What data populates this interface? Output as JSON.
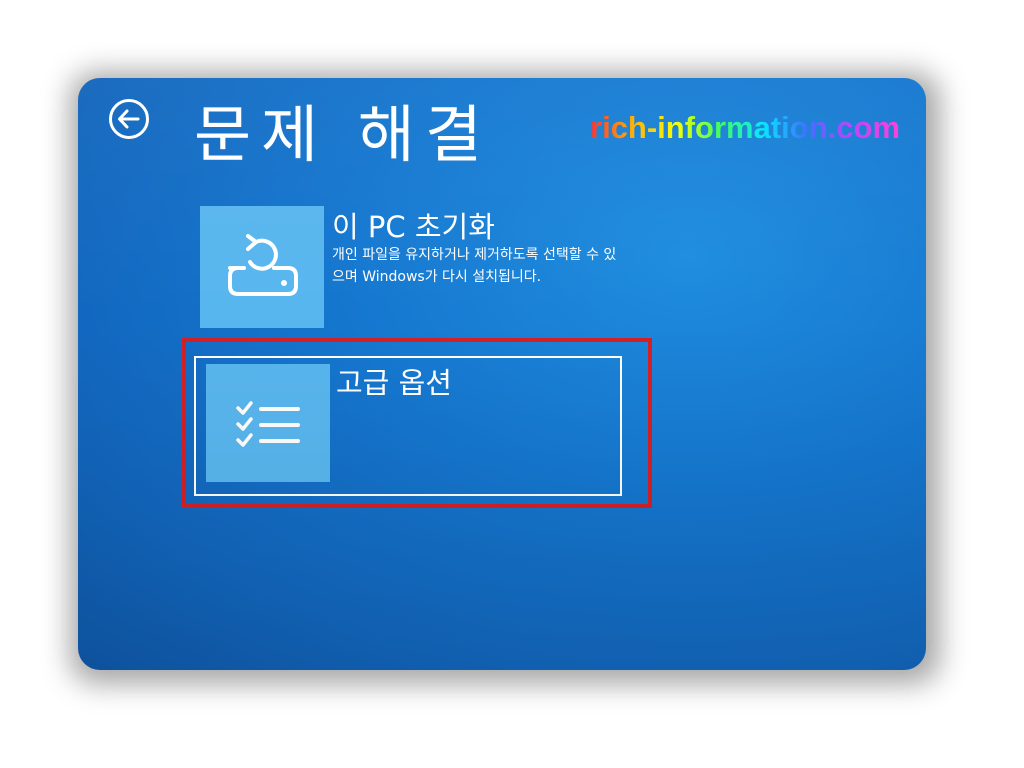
{
  "header": {
    "title": "문제 해결",
    "back_icon": "back-arrow-circle-icon"
  },
  "watermark": {
    "text": "rich-information.com"
  },
  "options": {
    "reset": {
      "title": "이 PC 초기화",
      "description": "개인 파일을 유지하거나 제거하도록 선택할 수 있으며 Windows가 다시 설치됩니다.",
      "icon": "reset-pc-icon"
    },
    "advanced": {
      "title": "고급 옵션",
      "icon": "checklist-icon"
    }
  },
  "colors": {
    "background": "#1577cf",
    "tile": "#58b6ee",
    "text": "#ffffff",
    "highlight": "#d42026"
  }
}
